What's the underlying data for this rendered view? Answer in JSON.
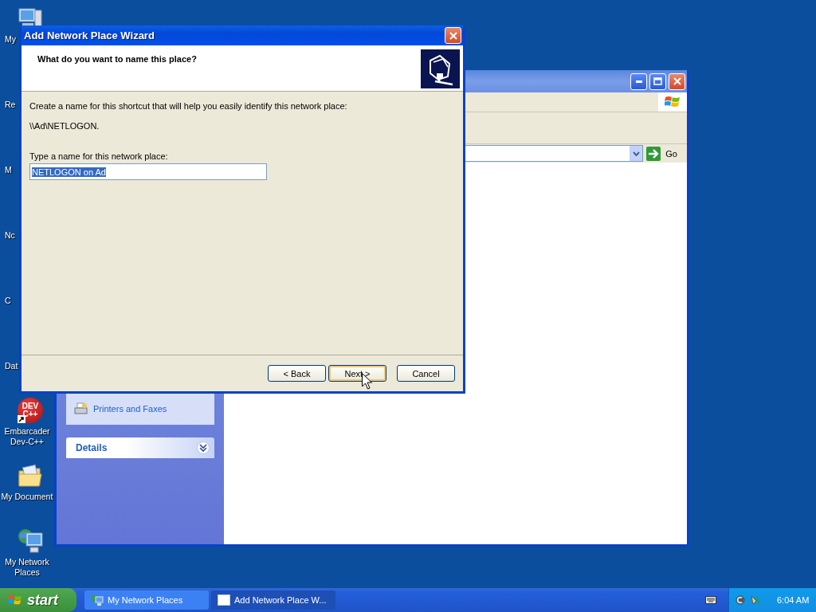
{
  "desktop_icons": [
    {
      "kind": "computer",
      "label": "My"
    },
    {
      "kind": "hidden",
      "label": "Re"
    },
    {
      "kind": "hidden",
      "label": "M"
    },
    {
      "kind": "hidden",
      "label": "Nc"
    },
    {
      "kind": "hidden",
      "label": "C"
    },
    {
      "kind": "hidden",
      "label": "Dat"
    },
    {
      "kind": "devcpp",
      "label": "Embarcader\nDev-C++",
      "badge": "DEV\nC++"
    },
    {
      "kind": "documents",
      "label": "My Document"
    },
    {
      "kind": "network",
      "label": "My Network\nPlaces"
    }
  ],
  "explorer": {
    "address_go": "Go",
    "task_pane": {
      "items": [
        {
          "kind": "printer",
          "label": "Printers and Faxes"
        }
      ],
      "details": {
        "title": "Details",
        "expanded": false
      }
    }
  },
  "wizard": {
    "title": "Add Network Place Wizard",
    "heading": "What do you want to name this place?",
    "description": "Create a name for this shortcut that will help you easily identify this network place:",
    "path": "\\\\Ad\\NETLOGON.",
    "field_label": "Type a name for this network place:",
    "field_value": "NETLOGON on Ad",
    "text_selected": true,
    "buttons": [
      {
        "label": "< Back",
        "default": false
      },
      {
        "label": "Next >",
        "default": true
      },
      {
        "label": "Cancel",
        "default": false
      }
    ]
  },
  "taskbar": {
    "start": "start",
    "tasks": [
      {
        "kind": "network",
        "label": "My Network Places",
        "selected": false
      },
      {
        "kind": "window",
        "label": "Add Network Place W...",
        "selected": true
      }
    ],
    "clock": "6:04 AM"
  }
}
